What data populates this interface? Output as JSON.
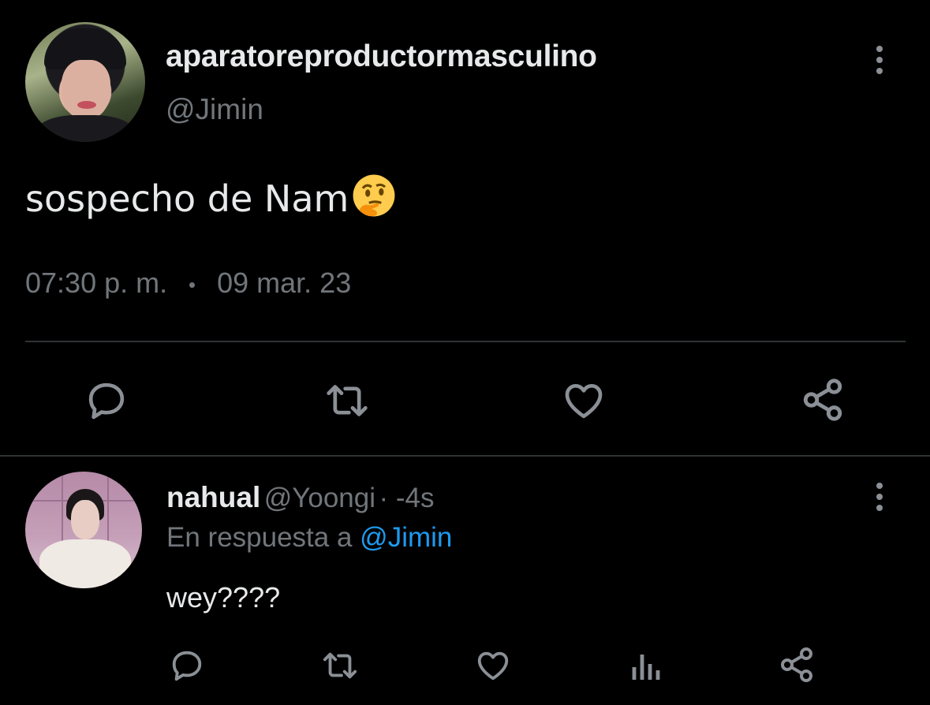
{
  "tweet": {
    "display_name": "aparatoreproductormasculino",
    "handle": "@Jimin",
    "text": "sospecho de Nam",
    "emoji": "thinking-face-emoji",
    "time": "07:30 p. m.",
    "date": "09 mar. 23",
    "actions": [
      "reply-icon",
      "retweet-icon",
      "like-icon",
      "share-icon"
    ]
  },
  "reply": {
    "display_name": "nahual",
    "handle": "@Yoongi",
    "age": "· -4s",
    "replying_prefix": "En respuesta a",
    "replying_to": "@Jimin",
    "text": "wey????",
    "actions": [
      "reply-icon",
      "retweet-icon",
      "like-icon",
      "analytics-icon",
      "share-icon"
    ]
  },
  "colors": {
    "background": "#000000",
    "text": "#e7e9ea",
    "muted": "#71767b",
    "icon": "#8b9096",
    "divider": "#2f3336",
    "link": "#1d9bf0"
  }
}
